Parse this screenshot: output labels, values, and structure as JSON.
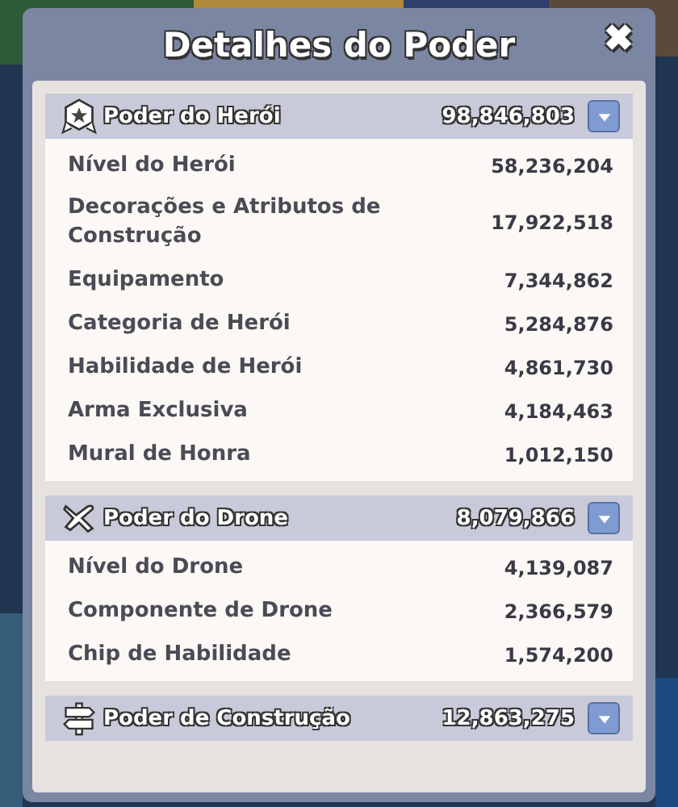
{
  "dialog": {
    "title": "Detalhes do Poder",
    "close": "✖"
  },
  "sections": [
    {
      "kind": "hero",
      "title": "Poder do Herói",
      "value": "98,846,803",
      "expanded": true,
      "rows": [
        {
          "label": "Nível do Herói",
          "value": "58,236,204"
        },
        {
          "label": "Decorações e Atributos de Construção",
          "value": "17,922,518"
        },
        {
          "label": "Equipamento",
          "value": "7,344,862"
        },
        {
          "label": "Categoria de Herói",
          "value": "5,284,876"
        },
        {
          "label": "Habilidade de Herói",
          "value": "4,861,730"
        },
        {
          "label": "Arma Exclusiva",
          "value": "4,184,463"
        },
        {
          "label": "Mural de Honra",
          "value": "1,012,150"
        }
      ]
    },
    {
      "kind": "drone",
      "title": "Poder do Drone",
      "value": "8,079,866",
      "expanded": true,
      "rows": [
        {
          "label": "Nível do Drone",
          "value": "4,139,087"
        },
        {
          "label": "Componente de Drone",
          "value": "2,366,579"
        },
        {
          "label": "Chip de Habilidade",
          "value": "1,574,200"
        }
      ]
    },
    {
      "kind": "construction",
      "title": "Poder de Construção",
      "value": "12,863,275",
      "expanded": false
    }
  ]
}
